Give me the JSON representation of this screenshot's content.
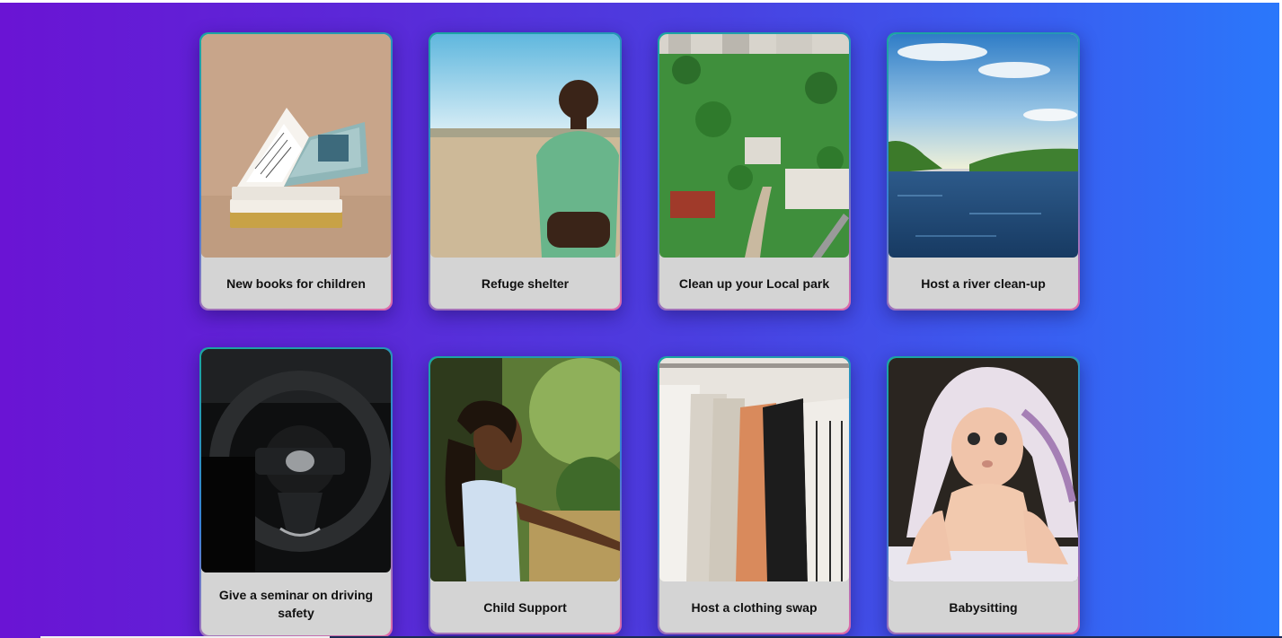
{
  "cards": [
    {
      "title": "New books for children",
      "image": "open-books-photo"
    },
    {
      "title": "Refuge shelter",
      "image": "boy-in-field-photo"
    },
    {
      "title": "Clean up your Local park",
      "image": "aerial-park-photo"
    },
    {
      "title": "Host a river clean-up",
      "image": "river-photo"
    },
    {
      "title": "Give a seminar on driving safety",
      "image": "steering-wheel-photo"
    },
    {
      "title": "Child Support",
      "image": "smiling-girl-photo"
    },
    {
      "title": "Host a clothing swap",
      "image": "clothing-rack-photo"
    },
    {
      "title": "Babysitting",
      "image": "baby-photo"
    }
  ],
  "colors": {
    "background_start": "#6a14d4",
    "background_end": "#2a78fb",
    "card_caption_bg": "#d4d4d4",
    "card_border_top": "#1aa6a0",
    "card_border_bottom": "#e06aa8"
  }
}
